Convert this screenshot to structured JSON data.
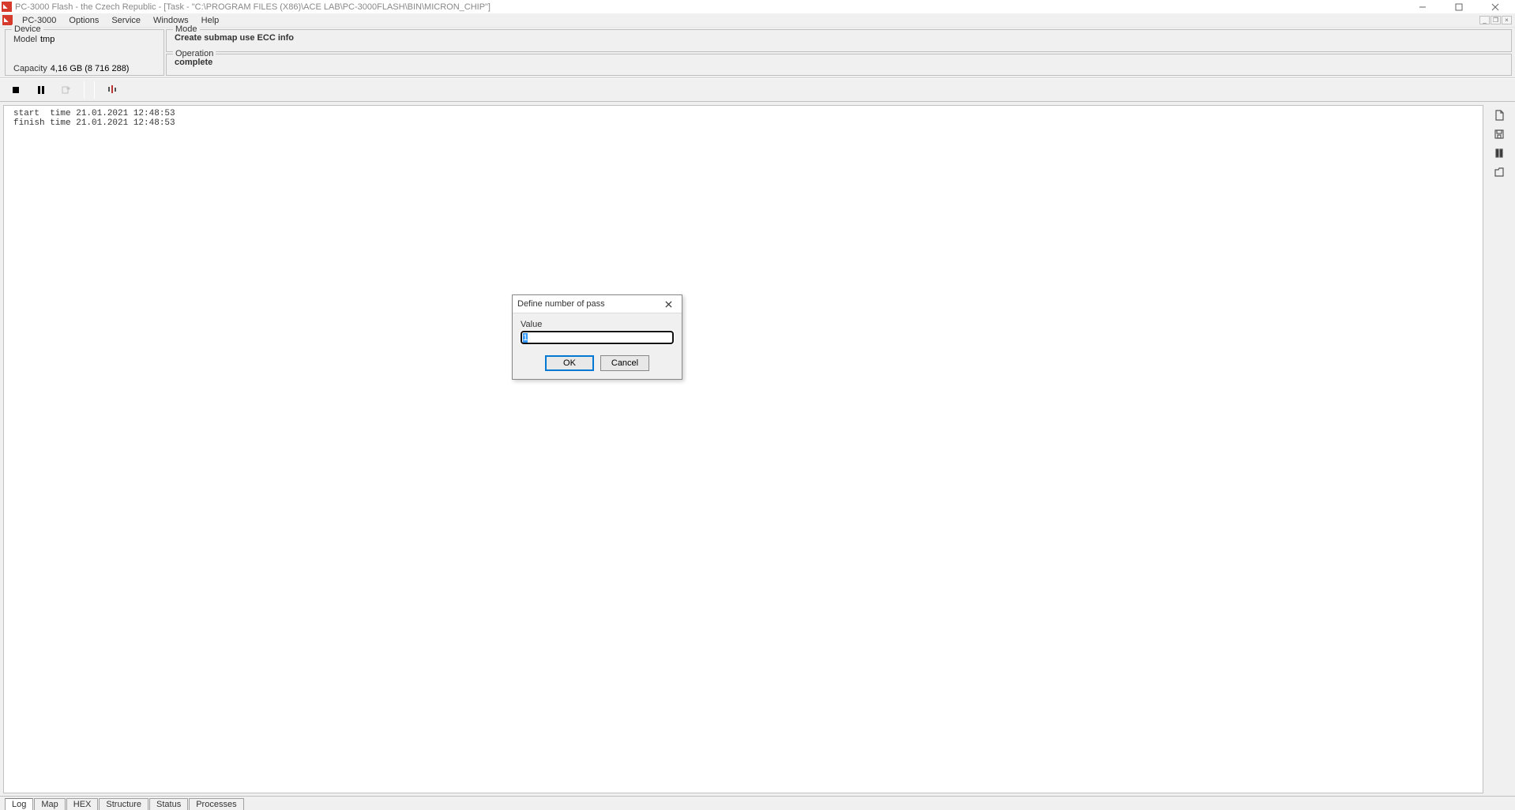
{
  "titlebar": {
    "text": "PC-3000 Flash - the Czech Republic - [Task - \"C:\\PROGRAM FILES (X86)\\ACE LAB\\PC-3000FLASH\\BIN\\MICRON_CHIP\"]"
  },
  "menu": {
    "items": [
      "PC-3000",
      "Options",
      "Service",
      "Windows",
      "Help"
    ]
  },
  "device": {
    "legend": "Device",
    "model_label": "Model",
    "model_value": "tmp",
    "capacity_label": "Capacity",
    "capacity_value": "4,16 GB (8 716 288)"
  },
  "mode": {
    "legend": "Mode",
    "value": "Create submap use ECC info"
  },
  "operation": {
    "legend": "Operation",
    "value": "complete"
  },
  "log": {
    "line1": "start  time 21.01.2021 12:48:53",
    "line2": "finish time 21.01.2021 12:48:53"
  },
  "tabs": [
    "Log",
    "Map",
    "HEX",
    "Structure",
    "Status",
    "Processes"
  ],
  "dialog": {
    "title": "Define number of pass",
    "label": "Value",
    "value": "1",
    "ok": "OK",
    "cancel": "Cancel"
  }
}
